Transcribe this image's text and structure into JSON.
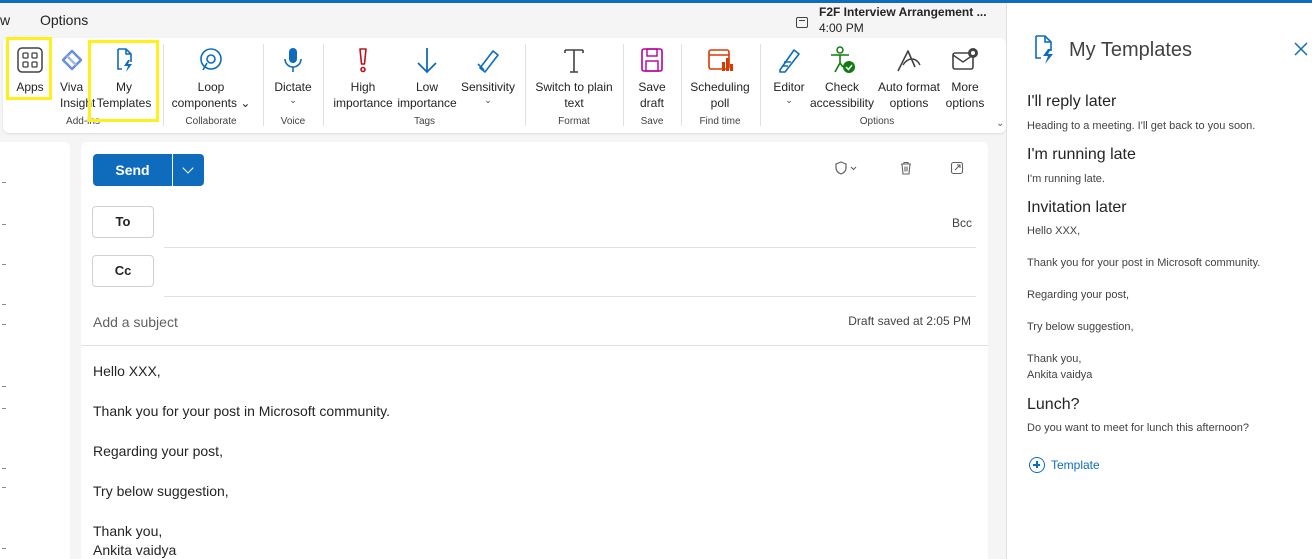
{
  "colors": {
    "accent": "#0f6cbd",
    "highlight": "#ffef1a"
  },
  "menu": {
    "partial_tab": "w",
    "options_tab": "Options"
  },
  "meeting": {
    "title": "F2F Interview Arrangement ...",
    "time": "4:00 PM",
    "icon": "calendar-icon"
  },
  "ribbon": {
    "apps": "Apps",
    "viva": [
      "Viva",
      "Insight"
    ],
    "my_templates": [
      "My",
      "Templates"
    ],
    "addins_group": "Add-ins",
    "loop": [
      "Loop",
      "components"
    ],
    "collaborate_group": "Collaborate",
    "dictate": "Dictate",
    "voice_group": "Voice",
    "high": [
      "High",
      "importance"
    ],
    "low": [
      "Low",
      "importance"
    ],
    "sensitivity": "Sensitivity",
    "tags_group": "Tags",
    "plain": [
      "Switch to plain",
      "text"
    ],
    "format_group": "Format",
    "save": [
      "Save",
      "draft"
    ],
    "save_group": "Save",
    "poll": [
      "Scheduling",
      "poll"
    ],
    "findtime_group": "Find time",
    "editor": "Editor",
    "check": [
      "Check",
      "accessibility"
    ],
    "autoformat": [
      "Auto format",
      "options"
    ],
    "more": [
      "More",
      "options"
    ],
    "options_group": "Options",
    "chevron": "⌄"
  },
  "compose": {
    "send": "Send",
    "to": "To",
    "cc": "Cc",
    "bcc": "Bcc",
    "subject_placeholder": "Add a subject",
    "draft_status": "Draft saved at 2:05 PM",
    "body": [
      "Hello XXX,",
      "Thank you for your post in Microsoft community.",
      "Regarding your post,",
      "Try below suggestion,",
      "Thank you,",
      "Ankita vaidya"
    ]
  },
  "pane": {
    "title": "My Templates",
    "templates": [
      {
        "title": "I'll reply later",
        "lines": [
          "Heading to a meeting. I'll get back to you soon."
        ]
      },
      {
        "title": "I'm running late",
        "lines": [
          "I'm running late."
        ]
      },
      {
        "title": "Invitation later",
        "lines": [
          "Hello XXX,",
          "Thank you for your post in Microsoft community.",
          "Regarding your post,",
          "Try below suggestion,",
          "Thank you,",
          "Ankita vaidya"
        ]
      },
      {
        "title": "Lunch?",
        "lines": [
          "Do you want to meet for lunch this afternoon?"
        ]
      }
    ],
    "add_label": "Template"
  }
}
